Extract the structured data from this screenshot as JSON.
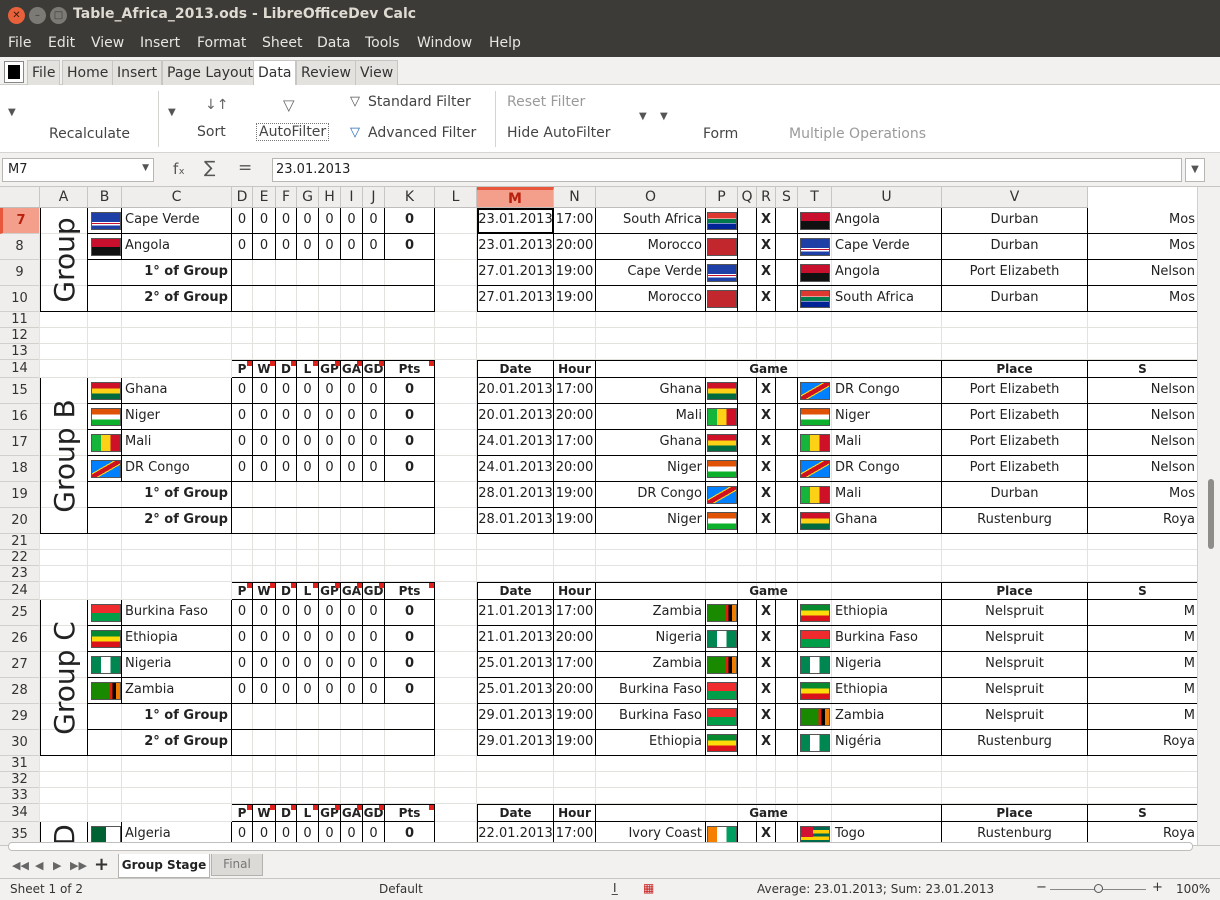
{
  "window": {
    "title": "Table_Africa_2013.ods - LibreOfficeDev Calc"
  },
  "menu": [
    "File",
    "Edit",
    "View",
    "Insert",
    "Format",
    "Sheet",
    "Data",
    "Tools",
    "Window",
    "Help"
  ],
  "tabs": [
    "File",
    "Home",
    "Insert",
    "Page Layout",
    "Data",
    "Review",
    "View"
  ],
  "active_tab": "Data",
  "ribbon": {
    "recalculate": "Recalculate",
    "sort": "Sort",
    "autofilter": "AutoFilter",
    "standard_filter": "Standard Filter",
    "advanced_filter": "Advanced Filter",
    "reset_filter": "Reset Filter",
    "hide_autofilter": "Hide AutoFilter",
    "form": "Form",
    "multiple_operations": "Multiple Operations"
  },
  "formula": {
    "cell_ref": "M7",
    "fx": "fₓ",
    "sigma": "∑",
    "equals": "=",
    "content": "23.01.2013"
  },
  "columns": [
    "A",
    "B",
    "C",
    "D",
    "E",
    "F",
    "G",
    "H",
    "I",
    "J",
    "K",
    "L",
    "M",
    "N",
    "O",
    "P",
    "Q",
    "R",
    "S",
    "T",
    "U",
    "V"
  ],
  "selected_column": "M",
  "row_numbers": [
    "7",
    "8",
    "9",
    "10",
    "11",
    "12",
    "13",
    "14",
    "15",
    "16",
    "17",
    "18",
    "19",
    "20",
    "21",
    "22",
    "23",
    "24",
    "25",
    "26",
    "27",
    "28",
    "29",
    "30",
    "31",
    "32",
    "33",
    "34",
    "35"
  ],
  "selected_row": "7",
  "stat_headers": [
    "P",
    "W",
    "D",
    "L",
    "GP",
    "GA",
    "GD",
    "Pts"
  ],
  "match_headers": {
    "date": "Date",
    "hour": "Hour",
    "game": "Game",
    "place": "Place",
    "stadium_partial": "S"
  },
  "x_mark": "X",
  "zero": "0",
  "first_of_group": "1° of Group",
  "second_of_group": "2° of Group",
  "groups": [
    {
      "label": "Group",
      "teams": [
        {
          "name": "Cape Verde",
          "flag": "flag-cape-verde"
        },
        {
          "name": "Angola",
          "flag": "flag-angola"
        }
      ],
      "matches": [
        {
          "date": "23.01.2013",
          "hour": "17:00",
          "home": "South Africa",
          "home_flag": "flag-south-africa",
          "away": "Angola",
          "away_flag": "flag-angola",
          "place": "Durban",
          "stadium": "Mos"
        },
        {
          "date": "23.01.2013",
          "hour": "20:00",
          "home": "Morocco",
          "home_flag": "flag-morocco",
          "away": "Cape Verde",
          "away_flag": "flag-cape-verde",
          "place": "Durban",
          "stadium": "Mos"
        },
        {
          "date": "27.01.2013",
          "hour": "19:00",
          "home": "Cape Verde",
          "home_flag": "flag-cape-verde",
          "away": "Angola",
          "away_flag": "flag-angola",
          "place": "Port Elizabeth",
          "stadium": "Nelson"
        },
        {
          "date": "27.01.2013",
          "hour": "19:00",
          "home": "Morocco",
          "home_flag": "flag-morocco",
          "away": "South Africa",
          "away_flag": "flag-south-africa",
          "place": "Durban",
          "stadium": "Mos"
        }
      ]
    },
    {
      "label": "Group B",
      "teams": [
        {
          "name": "Ghana",
          "flag": "flag-ghana"
        },
        {
          "name": "Niger",
          "flag": "flag-niger"
        },
        {
          "name": "Mali",
          "flag": "flag-mali"
        },
        {
          "name": "DR Congo",
          "flag": "flag-dr-congo"
        }
      ],
      "matches": [
        {
          "date": "20.01.2013",
          "hour": "17:00",
          "home": "Ghana",
          "home_flag": "flag-ghana",
          "away": "DR Congo",
          "away_flag": "flag-dr-congo",
          "place": "Port Elizabeth",
          "stadium": "Nelson"
        },
        {
          "date": "20.01.2013",
          "hour": "20:00",
          "home": "Mali",
          "home_flag": "flag-mali",
          "away": "Niger",
          "away_flag": "flag-niger",
          "place": "Port Elizabeth",
          "stadium": "Nelson"
        },
        {
          "date": "24.01.2013",
          "hour": "17:00",
          "home": "Ghana",
          "home_flag": "flag-ghana",
          "away": "Mali",
          "away_flag": "flag-mali",
          "place": "Port Elizabeth",
          "stadium": "Nelson"
        },
        {
          "date": "24.01.2013",
          "hour": "20:00",
          "home": "Niger",
          "home_flag": "flag-niger",
          "away": "DR Congo",
          "away_flag": "flag-dr-congo",
          "place": "Port Elizabeth",
          "stadium": "Nelson"
        },
        {
          "date": "28.01.2013",
          "hour": "19:00",
          "home": "DR Congo",
          "home_flag": "flag-dr-congo",
          "away": "Mali",
          "away_flag": "flag-mali",
          "place": "Durban",
          "stadium": "Mos"
        },
        {
          "date": "28.01.2013",
          "hour": "19:00",
          "home": "Niger",
          "home_flag": "flag-niger",
          "away": "Ghana",
          "away_flag": "flag-ghana",
          "place": "Rustenburg",
          "stadium": "Roya"
        }
      ]
    },
    {
      "label": "Group C",
      "teams": [
        {
          "name": "Burkina Faso",
          "flag": "flag-burkina-faso"
        },
        {
          "name": "Ethiopia",
          "flag": "flag-ethiopia"
        },
        {
          "name": "Nigeria",
          "flag": "flag-nigeria"
        },
        {
          "name": "Zambia",
          "flag": "flag-zambia"
        }
      ],
      "matches": [
        {
          "date": "21.01.2013",
          "hour": "17:00",
          "home": "Zambia",
          "home_flag": "flag-zambia",
          "away": "Ethiopia",
          "away_flag": "flag-ethiopia",
          "place": "Nelspruit",
          "stadium": "M"
        },
        {
          "date": "21.01.2013",
          "hour": "20:00",
          "home": "Nigeria",
          "home_flag": "flag-nigeria",
          "away": "Burkina Faso",
          "away_flag": "flag-burkina-faso",
          "place": "Nelspruit",
          "stadium": "M"
        },
        {
          "date": "25.01.2013",
          "hour": "17:00",
          "home": "Zambia",
          "home_flag": "flag-zambia",
          "away": "Nigeria",
          "away_flag": "flag-nigeria",
          "place": "Nelspruit",
          "stadium": "M"
        },
        {
          "date": "25.01.2013",
          "hour": "20:00",
          "home": "Burkina Faso",
          "home_flag": "flag-burkina-faso",
          "away": "Ethiopia",
          "away_flag": "flag-ethiopia",
          "place": "Nelspruit",
          "stadium": "M"
        },
        {
          "date": "29.01.2013",
          "hour": "19:00",
          "home": "Burkina Faso",
          "home_flag": "flag-burkina-faso",
          "away": "Zambia",
          "away_flag": "flag-zambia",
          "place": "Nelspruit",
          "stadium": "M"
        },
        {
          "date": "29.01.2013",
          "hour": "19:00",
          "home": "Ethiopia",
          "home_flag": "flag-ethiopia",
          "away": "Nigéria",
          "away_flag": "flag-nigeria",
          "place": "Rustenburg",
          "stadium": "Roya"
        }
      ]
    },
    {
      "label": "D",
      "teams": [
        {
          "name": "Algeria",
          "flag": "flag-algeria"
        }
      ],
      "matches": [
        {
          "date": "22.01.2013",
          "hour": "17:00",
          "home": "Ivory Coast",
          "home_flag": "flag-ivory-coast",
          "away": "Togo",
          "away_flag": "flag-togo",
          "place": "Rustenburg",
          "stadium": "Roya"
        }
      ]
    }
  ],
  "sheet_tabs": [
    "Group Stage",
    "Final"
  ],
  "active_sheet": "Group Stage",
  "status": {
    "sheet": "Sheet 1 of 2",
    "style": "Default",
    "summary": "Average: 23.01.2013; Sum: 23.01.2013",
    "zoom": "100%",
    "zoom_minus": "−",
    "zoom_plus": "+"
  }
}
